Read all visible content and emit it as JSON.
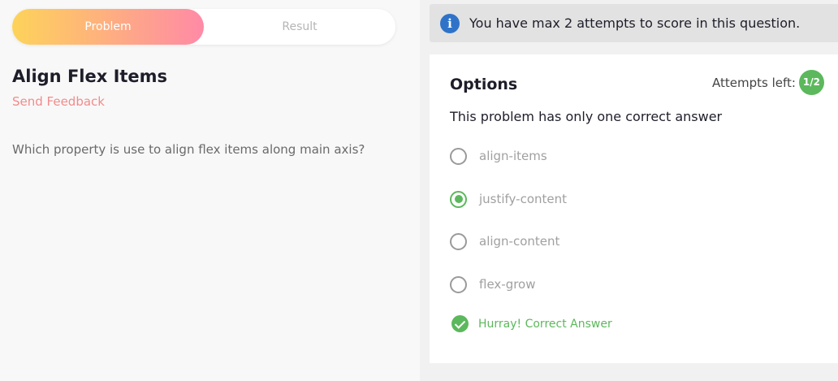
{
  "tabs": {
    "problem": "Problem",
    "result": "Result"
  },
  "problem": {
    "title": "Align Flex Items",
    "feedback_link": "Send Feedback",
    "question": "Which property is use to align flex items along main axis?"
  },
  "info": {
    "icon": "info-icon",
    "text": "You have max 2 attempts to score in this question."
  },
  "options_panel": {
    "title": "Options",
    "attempts_label": "Attempts left:",
    "attempts_value": "1/2",
    "subtitle": "This problem has only one correct answer",
    "options": [
      {
        "label": "align-items",
        "selected": false
      },
      {
        "label": "justify-content",
        "selected": true
      },
      {
        "label": "align-content",
        "selected": false
      },
      {
        "label": "flex-grow",
        "selected": false
      }
    ],
    "result_text": "Hurray! Correct Answer"
  },
  "colors": {
    "accent_green": "#5cb85c",
    "info_blue": "#2f73c9",
    "feedback_pink": "#f28b8b",
    "tab_gradient_start": "#fdd35a",
    "tab_gradient_end": "#ff8aa6"
  }
}
